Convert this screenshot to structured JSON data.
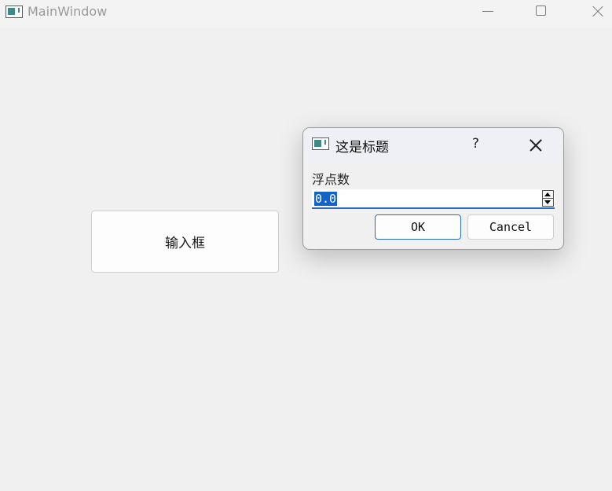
{
  "window": {
    "title": "MainWindow",
    "icons": {
      "app": "app-window-icon",
      "minimize": "minimize-icon",
      "maximize": "maximize-icon",
      "close": "close-icon"
    }
  },
  "main": {
    "button_label": "输入框"
  },
  "dialog": {
    "title": "这是标题",
    "help_label": "?",
    "field_label": "浮点数",
    "spin_value": "0.0",
    "ok_label": "OK",
    "cancel_label": "Cancel",
    "accent_color": "#1264c8"
  }
}
